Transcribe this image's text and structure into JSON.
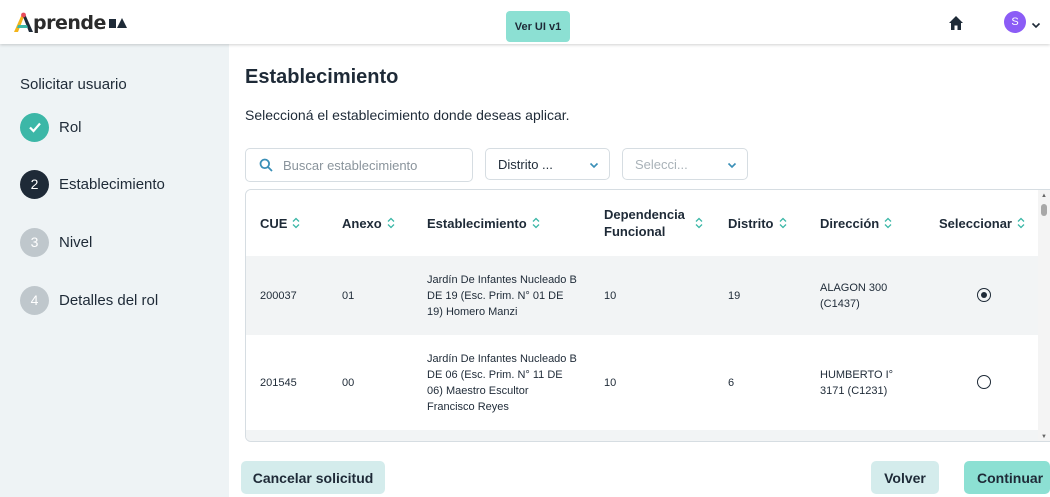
{
  "header": {
    "logo_text": "prende",
    "logo_suffix": "BA",
    "version_button": "Ver UI v1",
    "avatar_initial": "S",
    "colors": {
      "accent": "#8ce0d3",
      "avatar": "#8b5cf6",
      "text": "#1e2a37"
    }
  },
  "sidebar": {
    "title": "Solicitar usuario",
    "steps": [
      {
        "number": "✓",
        "label": "Rol",
        "state": "done"
      },
      {
        "number": "2",
        "label": "Establecimiento",
        "state": "active"
      },
      {
        "number": "3",
        "label": "Nivel",
        "state": "pending"
      },
      {
        "number": "4",
        "label": "Detalles del rol",
        "state": "pending"
      }
    ]
  },
  "main": {
    "title": "Establecimiento",
    "subtitle": "Seleccioná el establecimiento donde deseas aplicar.",
    "search": {
      "placeholder": "Buscar establecimiento",
      "value": ""
    },
    "filters": {
      "distrito": "Distrito ...",
      "other": "Selecci..."
    },
    "table": {
      "columns": [
        "CUE",
        "Anexo",
        "Establecimiento",
        "Dependencia Funcional",
        "Distrito",
        "Dirección",
        "Seleccionar"
      ],
      "column_dependencia_lines": [
        "Dependencia",
        "Funcional"
      ],
      "rows": [
        {
          "cue": "200037",
          "anexo": "01",
          "establecimiento_lines": [
            "Jardín De Infantes Nucleado B",
            "DE 19 (Esc. Prim. N° 01 DE",
            "19) Homero Manzi"
          ],
          "dependencia": "10",
          "distrito": "19",
          "direccion_lines": [
            "ALAGON 300",
            "(C1437)"
          ],
          "selected": true
        },
        {
          "cue": "201545",
          "anexo": "00",
          "establecimiento_lines": [
            "Jardín De Infantes Nucleado B",
            "DE 06 (Esc. Prim. N° 11 DE",
            "06) Maestro Escultor",
            "Francisco Reyes"
          ],
          "dependencia": "10",
          "distrito": "6",
          "direccion_lines": [
            "HUMBERTO I°",
            "3171 (C1231)"
          ],
          "selected": false
        }
      ]
    }
  },
  "footer": {
    "cancel": "Cancelar solicitud",
    "back": "Volver",
    "continue": "Continuar"
  }
}
